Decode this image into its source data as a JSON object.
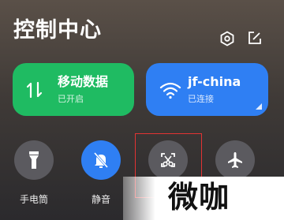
{
  "header": {
    "title": "控制中心",
    "settings_icon": "settings-hexagon-icon",
    "edit_icon": "edit-icon"
  },
  "tiles": {
    "mobile_data": {
      "name": "移动数据",
      "status": "已开启",
      "icon": "data-arrows-icon",
      "color": "#1fbb62"
    },
    "wifi": {
      "name": "jf-china",
      "status": "已连接",
      "icon": "wifi-icon",
      "color": "#2f7ff3"
    }
  },
  "toggles": [
    {
      "label": "手电筒",
      "icon": "flashlight-icon"
    },
    {
      "label": "静音",
      "icon": "mute-bell-icon"
    },
    {
      "label": "",
      "icon": "screenshot-scissors-icon"
    },
    {
      "label": "",
      "icon": "airplane-icon"
    }
  ],
  "watermark": {
    "text": "微咖"
  }
}
